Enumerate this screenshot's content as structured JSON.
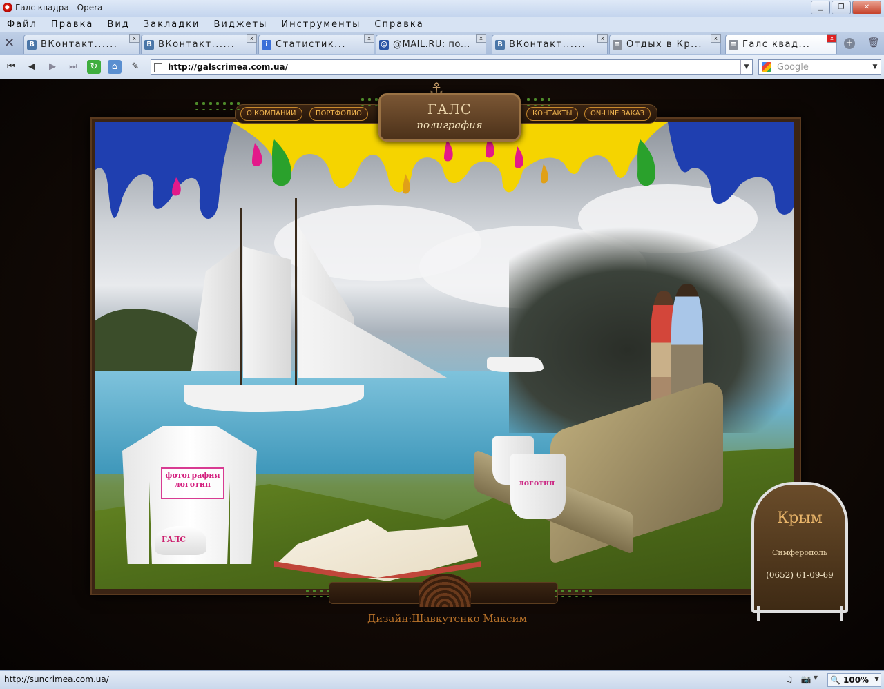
{
  "window": {
    "title": "Галс квадра - Opera"
  },
  "menu": [
    "Файл",
    "Правка",
    "Вид",
    "Закладки",
    "Виджеты",
    "Инструменты",
    "Справка"
  ],
  "tabs": [
    {
      "label": "ВКонтакт......",
      "icon": "vk-icon",
      "icon_char": "B",
      "icon_color": "#4a76a8"
    },
    {
      "label": "ВКонтакт......",
      "icon": "vk-icon",
      "icon_char": "B",
      "icon_color": "#4a76a8"
    },
    {
      "label": "Статистик...",
      "icon": "info-icon",
      "icon_char": "i",
      "icon_color": "#3a6fd8"
    },
    {
      "label": "@MAIL.RU: по...",
      "icon": "mail-icon",
      "icon_char": "@",
      "icon_color": "#2a55a5"
    },
    {
      "label": "ВКонтакт......",
      "icon": "vk-icon",
      "icon_char": "B",
      "icon_color": "#4a76a8"
    },
    {
      "label": "Отдых в Кр...",
      "icon": "document-icon",
      "icon_char": "≡",
      "icon_color": "#8a8f99"
    },
    {
      "label": "Галс квад...",
      "icon": "document-icon",
      "icon_char": "≡",
      "icon_color": "#8a8f99",
      "active": true
    }
  ],
  "address": {
    "url": "http://galscrimea.com.ua/"
  },
  "search": {
    "placeholder": "Google"
  },
  "site": {
    "nav": [
      "О КОМПАНИИ",
      "ПОРТФОЛИО",
      "КОНТАКТЫ",
      "ON-LINE ЗАКАЗ"
    ],
    "logo_top": "ГАЛС",
    "logo_sub": "полиграфия",
    "shirt_print_line1": "фотография",
    "shirt_print_line2": "логотип",
    "cap_text": "ГАЛС",
    "cup_text": "логотип",
    "sign_title": "Крым",
    "sign_city": "Симферополь",
    "sign_phone": "(0652) 61-09-69",
    "credit": "Дизайн:Шавкутенко  Максим"
  },
  "status": {
    "url": "http://suncrimea.com.ua/",
    "zoom": "100%"
  },
  "colors": {
    "accent_orange": "#f1b650",
    "paint_yellow": "#f5d400",
    "paint_blue": "#1f3fb0",
    "paint_pink": "#e3198a",
    "paint_green": "#2aa12c"
  }
}
